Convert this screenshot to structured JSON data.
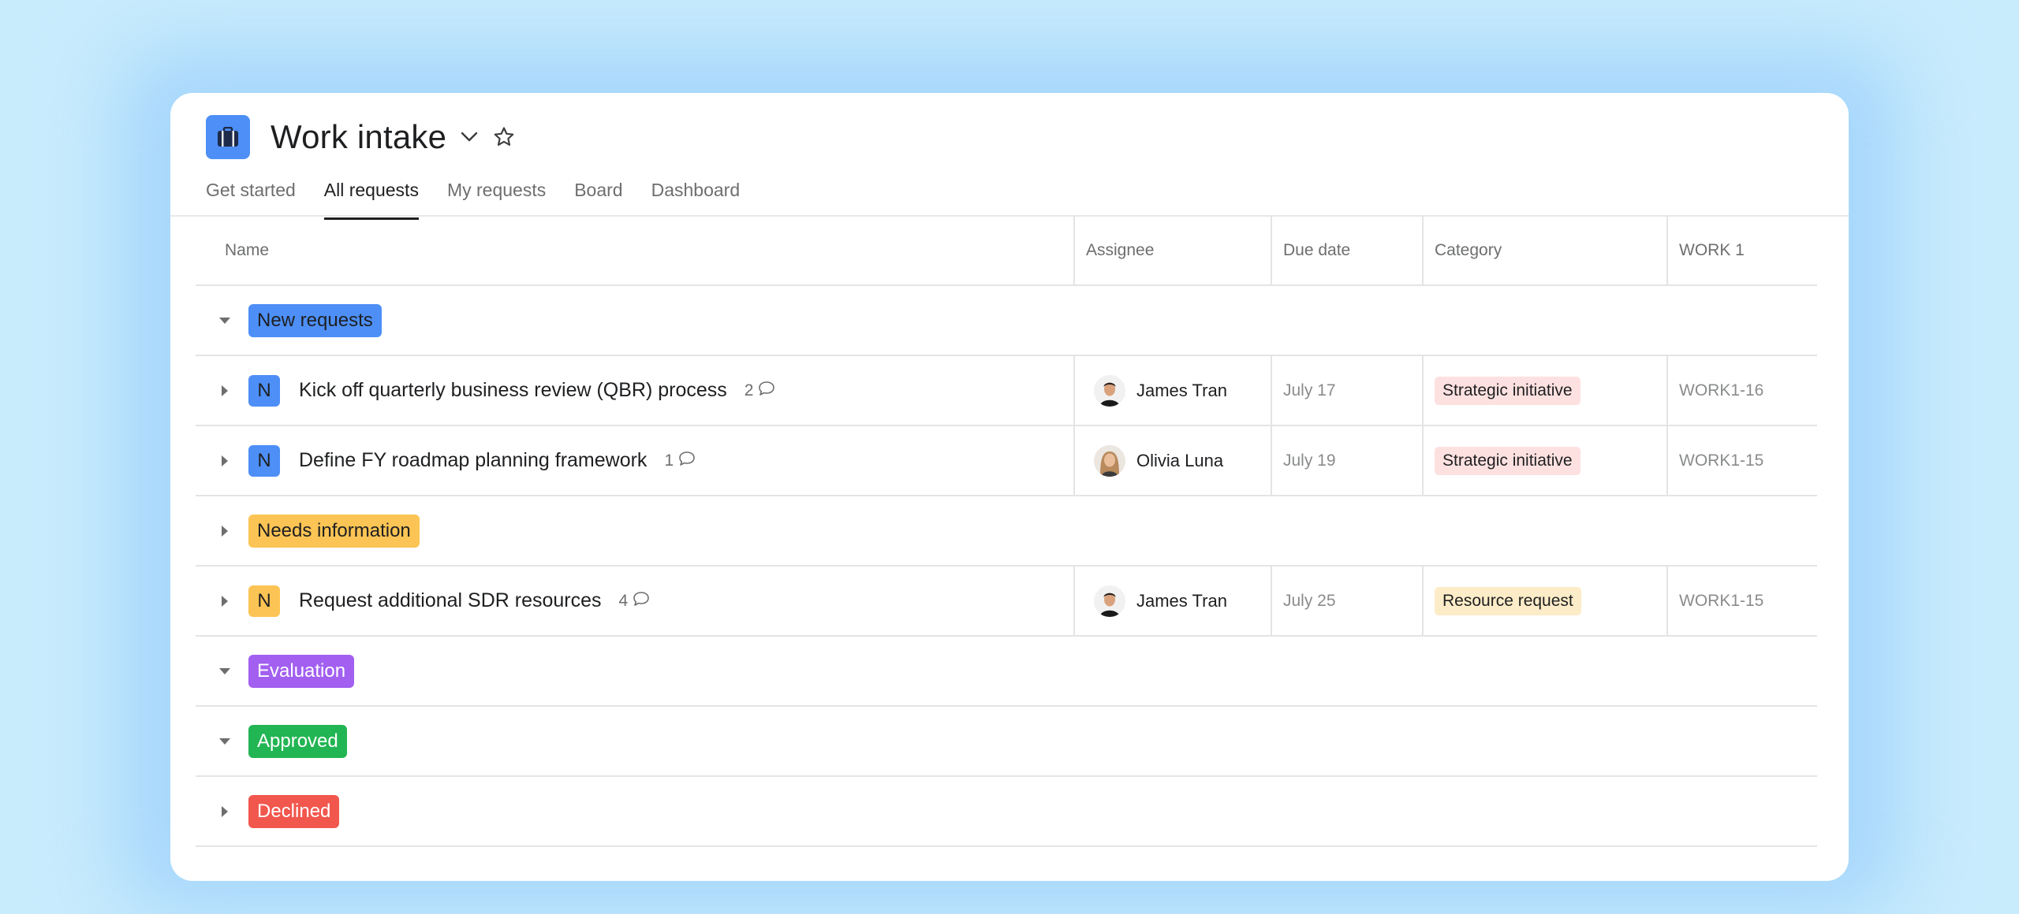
{
  "window": {
    "title": "Work intake",
    "tabs": [
      "Get started",
      "All requests",
      "My requests",
      "Board",
      "Dashboard"
    ],
    "active_tab": "All requests"
  },
  "columns": {
    "name": "Name",
    "assignee": "Assignee",
    "due_date": "Due date",
    "category": "Category",
    "work": "WORK 1"
  },
  "colors": {
    "new_requests": "#4d8ff7",
    "needs_information": "#fcc454",
    "evaluation": "#a25ff0",
    "approved": "#22b553",
    "declined": "#f1574d",
    "strategic_initiative": "#fde1e0",
    "resource_request": "#fdecc8"
  },
  "sections": [
    {
      "label": "New requests",
      "color": "#4d8ff7",
      "expanded": true,
      "tasks": [
        {
          "initial": "N",
          "name": "Kick off quarterly business review (QBR) process",
          "comments": "2",
          "assignee": "James Tran",
          "avatar": "man",
          "due": "July 17",
          "category": "Strategic initiative",
          "category_color": "#fde1e0",
          "work_id": "WORK1-16"
        },
        {
          "initial": "N",
          "name": "Define FY roadmap planning framework",
          "comments": "1",
          "assignee": "Olivia Luna",
          "avatar": "woman",
          "due": "July 19",
          "category": "Strategic initiative",
          "category_color": "#fde1e0",
          "work_id": "WORK1-15"
        }
      ]
    },
    {
      "label": "Needs information",
      "color": "#fcc454",
      "expanded": false,
      "tasks": [
        {
          "initial": "N",
          "name": "Request additional SDR resources",
          "comments": "4",
          "assignee": "James Tran",
          "avatar": "man",
          "due": "July 25",
          "category": "Resource request",
          "category_color": "#fdecc8",
          "work_id": "WORK1-15"
        }
      ]
    },
    {
      "label": "Evaluation",
      "color": "#a25ff0",
      "expanded": true,
      "tasks": []
    },
    {
      "label": "Approved",
      "color": "#22b553",
      "expanded": true,
      "tasks": []
    },
    {
      "label": "Declined",
      "color": "#f1574d",
      "expanded": false,
      "tasks": []
    }
  ]
}
